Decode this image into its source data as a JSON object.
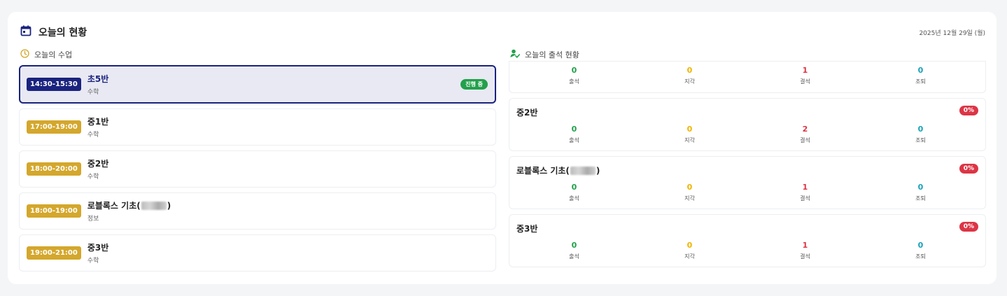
{
  "header": {
    "title": "오늘의 현황",
    "date": "2025년 12월 29일 (월)"
  },
  "classes_section": {
    "title": "오늘의 수업",
    "items": [
      {
        "time": "14:30-15:30",
        "name": "초5반",
        "subject": "수학",
        "status": "진행 중",
        "active": true
      },
      {
        "time": "17:00-19:00",
        "name": "중1반",
        "subject": "수학",
        "active": false
      },
      {
        "time": "18:00-20:00",
        "name": "중2반",
        "subject": "수학",
        "active": false
      },
      {
        "time": "18:00-19:00",
        "name_prefix": "로블록스 기초(",
        "name_suffix": ")",
        "subject": "정보",
        "active": false
      },
      {
        "time": "19:00-21:00",
        "name": "중3반",
        "subject": "수학",
        "active": false
      }
    ]
  },
  "attendance_section": {
    "title": "오늘의 출석 현황",
    "labels": {
      "present": "출석",
      "late": "지각",
      "absent": "결석",
      "early": "조퇴"
    },
    "groups": [
      {
        "present": "0",
        "late": "0",
        "absent": "1",
        "early": "0"
      },
      {
        "name": "중2반",
        "percent": "0%",
        "present": "0",
        "late": "0",
        "absent": "2",
        "early": "0"
      },
      {
        "name_prefix": "로블록스 기초(",
        "name_suffix": ")",
        "percent": "0%",
        "present": "0",
        "late": "0",
        "absent": "1",
        "early": "0"
      },
      {
        "name": "중3반",
        "percent": "0%",
        "present": "0",
        "late": "0",
        "absent": "1",
        "early": "0"
      }
    ]
  },
  "colors": {
    "navy": "#1a237e",
    "gold": "#d4a72c",
    "green": "#22a04b",
    "red": "#dc3545",
    "yellow": "#f0b400",
    "teal": "#17a2b8"
  },
  "icons": {
    "header": "calendar-icon",
    "classes": "clock-icon",
    "attendance": "user-check-icon"
  }
}
